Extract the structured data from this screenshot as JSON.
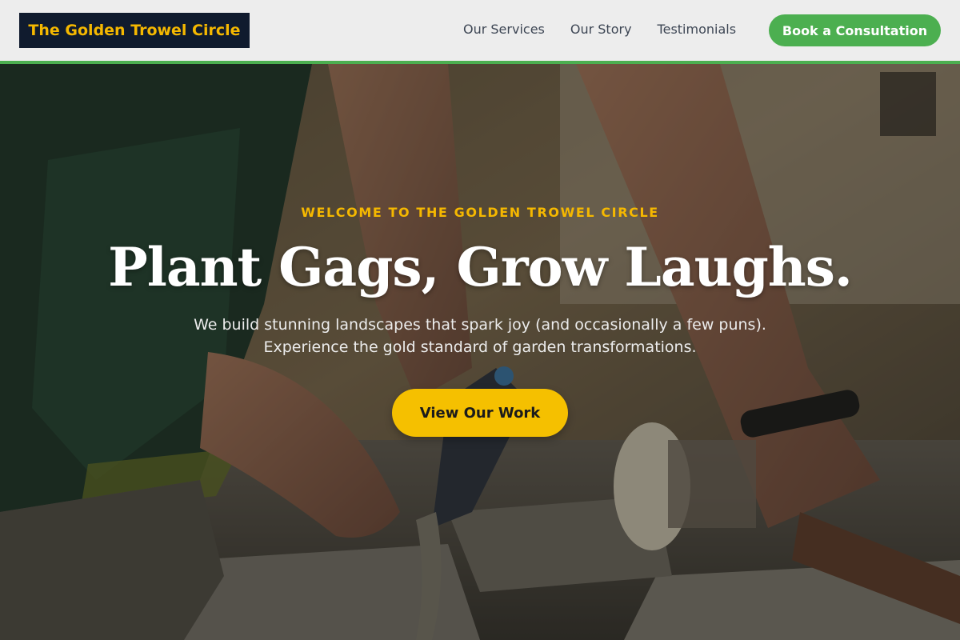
{
  "header": {
    "logo_text": "The Golden Trowel Circle",
    "nav": [
      {
        "label": "Our Services"
      },
      {
        "label": "Our Story"
      },
      {
        "label": "Testimonials"
      }
    ],
    "cta_label": "Book a Consultation"
  },
  "hero": {
    "eyebrow": "WELCOME TO THE GOLDEN TROWEL CIRCLE",
    "headline": "Plant Gags, Grow Laughs.",
    "subtitle_line1": "We build stunning landscapes that spark joy (and occasionally a few puns).",
    "subtitle_line2": "Experience the gold standard of garden transformations.",
    "button_label": "View Our Work"
  },
  "colors": {
    "logo_bg": "#101b2e",
    "gold": "#f5b800",
    "green": "#4caf50",
    "nav_text": "#3d4654"
  },
  "icons": {}
}
